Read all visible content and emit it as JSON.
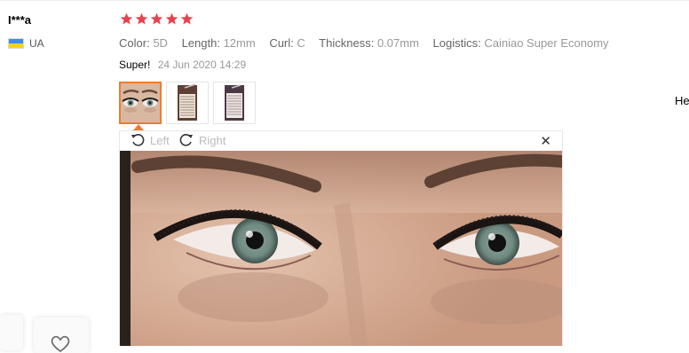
{
  "reviewer": {
    "name": "I***a",
    "country": "UA"
  },
  "rating": {
    "stars": 5,
    "max": 5,
    "color": "#e8424e"
  },
  "attributes": [
    {
      "key": "Color:",
      "value": "5D"
    },
    {
      "key": "Length:",
      "value": "12mm"
    },
    {
      "key": "Curl:",
      "value": "C"
    },
    {
      "key": "Thickness:",
      "value": "0.07mm"
    },
    {
      "key": "Logistics:",
      "value": "Cainiao Super Economy"
    }
  ],
  "review": {
    "text": "Super!",
    "date": "24 Jun 2020 14:29"
  },
  "thumbnails": [
    {
      "icon": "eyes-photo-thumbnail",
      "active": true
    },
    {
      "icon": "lash-tray-photo-thumbnail",
      "active": false
    },
    {
      "icon": "lash-tray-photo-thumbnail",
      "active": false
    }
  ],
  "viewer": {
    "rotate_left": "Left",
    "rotate_right": "Right",
    "close": "✕"
  },
  "side_text": "He",
  "accent_color": "#ef7b2c"
}
